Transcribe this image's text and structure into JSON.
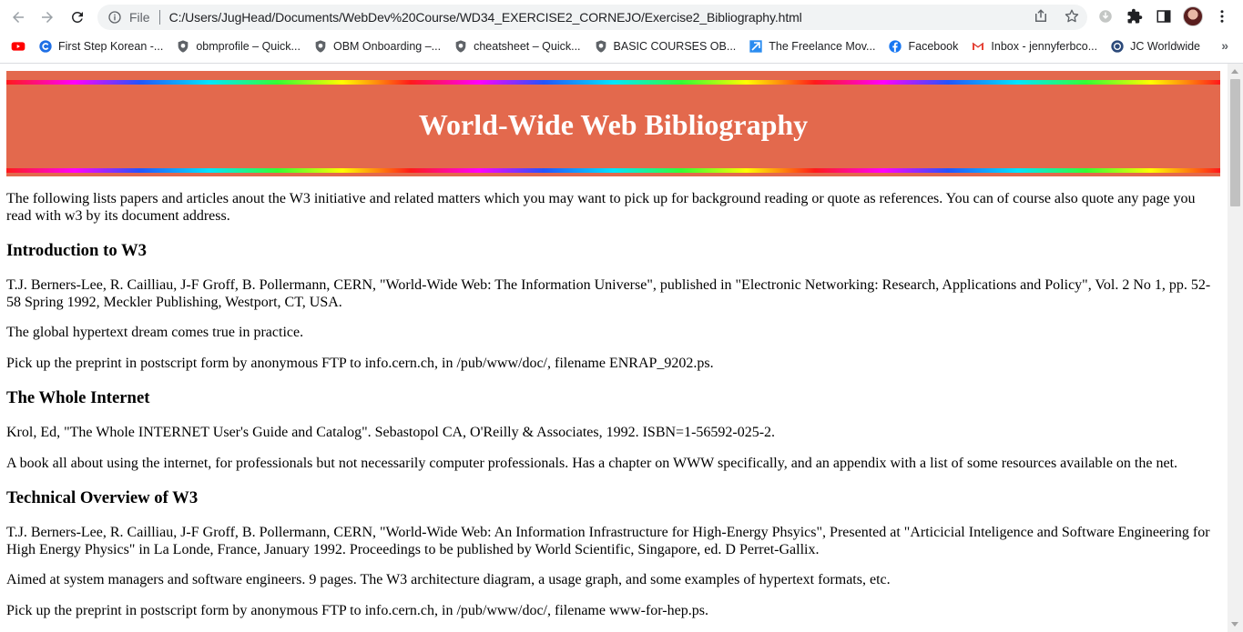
{
  "browser": {
    "scheme_label": "File",
    "url": "C:/Users/JugHead/Documents/WebDev%20Course/WD34_EXERCISE2_CORNEJO/Exercise2_Bibliography.html",
    "bookmarks": [
      {
        "label": "",
        "icon": "youtube-icon"
      },
      {
        "label": "First Step Korean -...",
        "icon": "coursera-icon"
      },
      {
        "label": "obmprofile – Quick...",
        "icon": "shield-icon"
      },
      {
        "label": "OBM Onboarding –...",
        "icon": "shield-icon"
      },
      {
        "label": "cheatsheet – Quick...",
        "icon": "shield-icon"
      },
      {
        "label": "BASIC COURSES OB...",
        "icon": "shield-icon"
      },
      {
        "label": "The Freelance Mov...",
        "icon": "freelance-icon"
      },
      {
        "label": "Facebook",
        "icon": "facebook-icon"
      },
      {
        "label": "Inbox - jennyferbco...",
        "icon": "gmail-icon"
      },
      {
        "label": "JC Worldwide",
        "icon": "jc-icon"
      }
    ],
    "more_bookmarks": "»"
  },
  "page": {
    "banner_title": "World-Wide Web Bibliography",
    "intro": "The following lists papers and articles anout the W3 initiative and related matters which you may want to pick up for background reading or quote as references. You can of course also quote any page you read with w3 by its document address.",
    "sections": [
      {
        "heading": "Introduction to W3",
        "paragraphs": [
          "T.J. Berners-Lee, R. Cailliau, J-F Groff, B. Pollermann, CERN, \"World-Wide Web: The Information Universe\", published in \"Electronic Networking: Research, Applications and Policy\", Vol. 2 No 1, pp. 52-58 Spring 1992, Meckler Publishing, Westport, CT, USA.",
          "The global hypertext dream comes true in practice.",
          "Pick up the preprint in postscript form by anonymous FTP to info.cern.ch, in /pub/www/doc/, filename ENRAP_9202.ps."
        ]
      },
      {
        "heading": "The Whole Internet",
        "paragraphs": [
          "Krol, Ed, \"The Whole INTERNET User's Guide and Catalog\". Sebastopol CA, O'Reilly & Associates, 1992. ISBN=1-56592-025-2.",
          "A book all about using the internet, for professionals but not necessarily computer professionals. Has a chapter on WWW specifically, and an appendix with a list of some resources available on the net."
        ]
      },
      {
        "heading": "Technical Overview of W3",
        "paragraphs": [
          "T.J. Berners-Lee, R. Cailliau, J-F Groff, B. Pollermann, CERN, \"World-Wide Web: An Information Infrastructure for High-Energy Phsyics\", Presented at \"Articicial Inteligence and Software Engineering for High Energy Physics\" in La Londe, France, January 1992. Proceedings to be published by World Scientific, Singapore, ed. D Perret-Gallix.",
          "Aimed at system managers and software engineers. 9 pages. The W3 architecture diagram, a usage graph, and some examples of hypertext formats, etc.",
          "Pick up the preprint in postscript form by anonymous FTP to info.cern.ch, in /pub/www/doc/, filename www-for-hep.ps."
        ]
      }
    ]
  },
  "colors": {
    "banner": "#e3694d",
    "banner_text": "#ffffff"
  }
}
